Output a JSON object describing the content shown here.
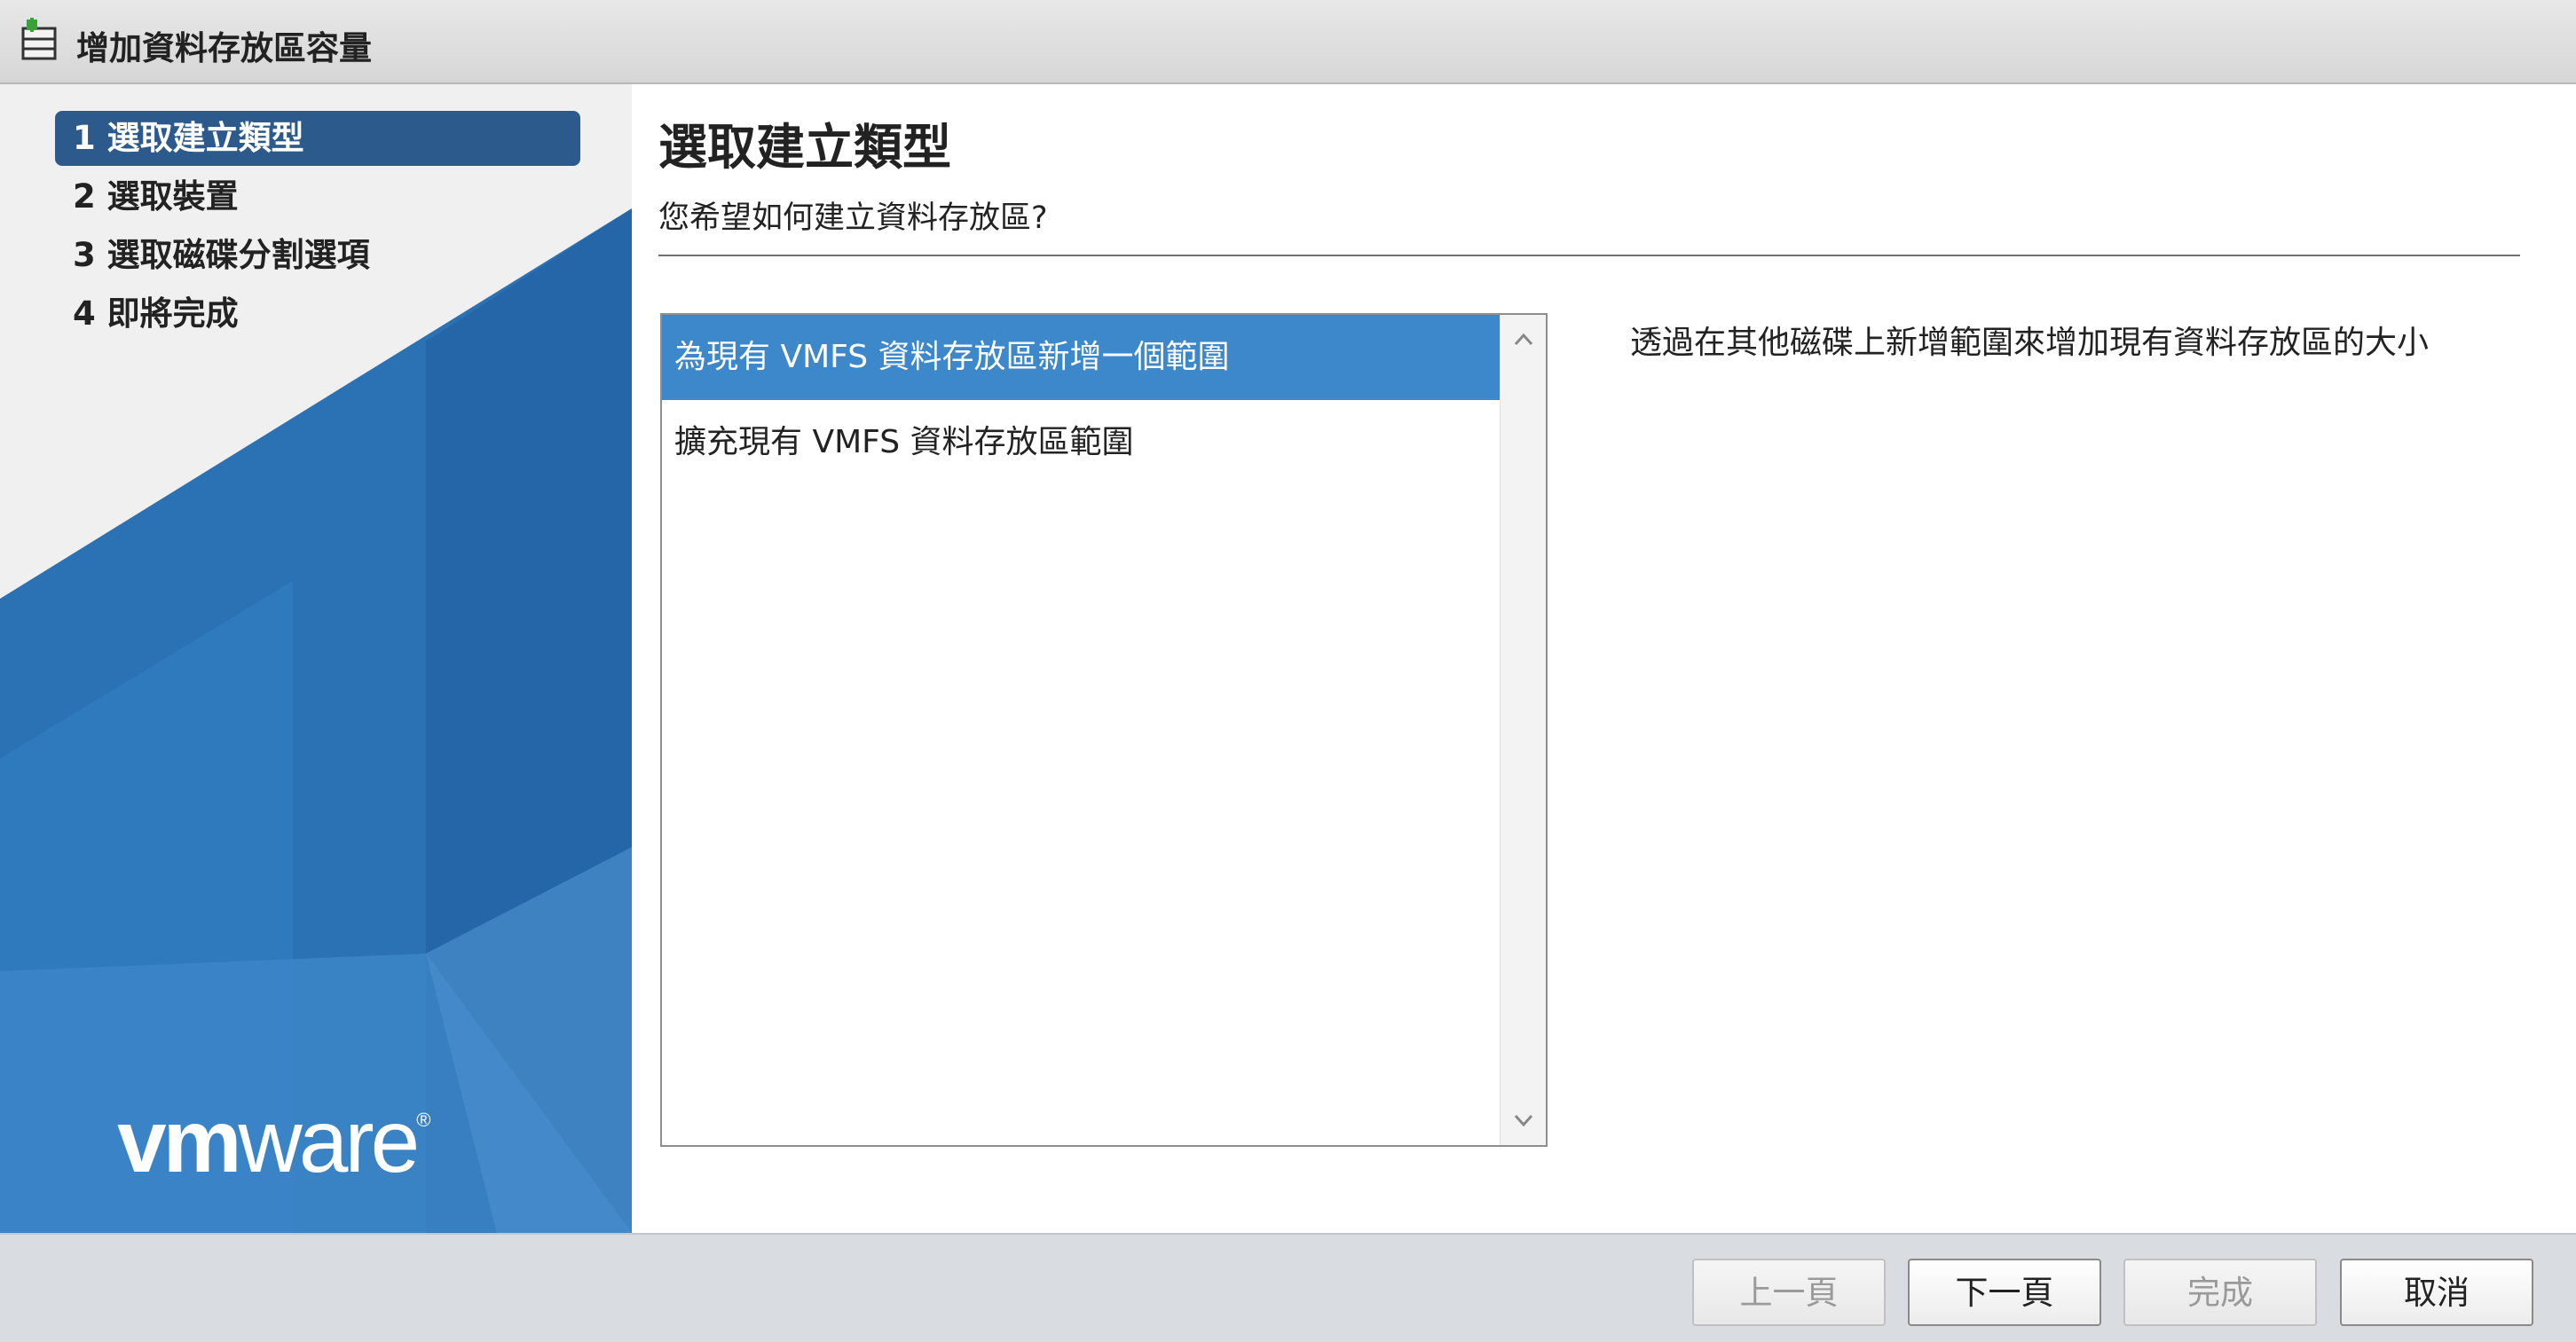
{
  "window": {
    "title": "增加資料存放區容量",
    "icon": "datastore-add-icon"
  },
  "steps": [
    {
      "label": "1 選取建立類型",
      "active": true
    },
    {
      "label": "2 選取裝置",
      "active": false
    },
    {
      "label": "3 選取磁碟分割選項",
      "active": false
    },
    {
      "label": "4 即將完成",
      "active": false
    }
  ],
  "brand": {
    "logo_vm": "vm",
    "logo_ware": "ware",
    "registered": "®"
  },
  "page": {
    "title": "選取建立類型",
    "subtitle": "您希望如何建立資料存放區?"
  },
  "options": [
    {
      "label": "為現有 VMFS 資料存放區新增一個範圍",
      "selected": true
    },
    {
      "label": "擴充現有 VMFS 資料存放區範圍",
      "selected": false
    }
  ],
  "description": "透過在其他磁碟上新增範圍來增加現有資料存放區的大小",
  "buttons": {
    "back": "上一頁",
    "next": "下一頁",
    "finish": "完成",
    "cancel": "取消"
  },
  "colors": {
    "accent": "#2d5a8c",
    "selection": "#3d87cb",
    "brand_blue": "#2b72b5"
  }
}
